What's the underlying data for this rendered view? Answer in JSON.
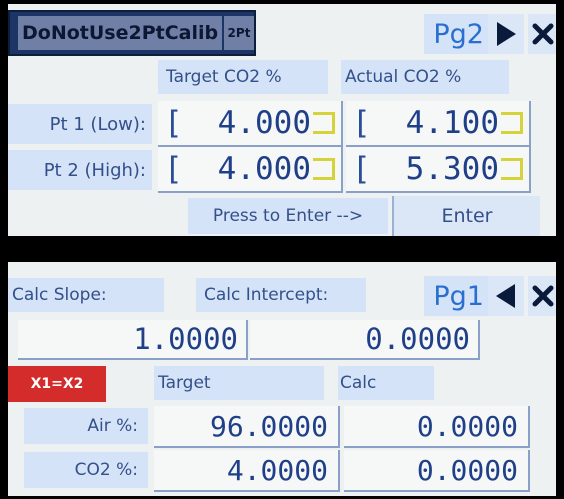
{
  "screen1": {
    "title": "DoNotUse2PtCalib",
    "mode_badge": "2Pt",
    "page_label": "Pg2",
    "next_icon": "play-right-icon",
    "close_icon": "close-x-icon",
    "col_target": "Target CO2 %",
    "col_actual": "Actual CO2 %",
    "rows": [
      {
        "label": "Pt 1 (Low):",
        "target": "4.000",
        "actual": "4.100"
      },
      {
        "label": "Pt 2 (High):",
        "target": "4.000",
        "actual": "5.300"
      }
    ],
    "bracket_open": "[",
    "prompt": "Press to Enter -->",
    "enter_label": "Enter"
  },
  "screen2": {
    "calc_slope_label": "Calc Slope:",
    "calc_intercept_label": "Calc Intercept:",
    "page_label": "Pg1",
    "prev_icon": "play-left-icon",
    "close_icon": "close-x-icon",
    "slope_value": "1.0000",
    "intercept_value": "0.0000",
    "x1x2_label": "X1=X2",
    "col_target": "Target",
    "col_calc": "Calc",
    "rows": [
      {
        "label": "Air %:",
        "target": "96.0000",
        "calc": "0.0000"
      },
      {
        "label": "CO2 %:",
        "target": "4.0000",
        "calc": "0.0000"
      }
    ]
  },
  "colors": {
    "screen_bg": "#eef1f2",
    "label_bg": "#d4e3f7",
    "text_blue": "#1f3f88",
    "title_bar": "#1d3566",
    "alert_red": "#d42b2b",
    "bracket_yellow": "#d6d23a"
  }
}
